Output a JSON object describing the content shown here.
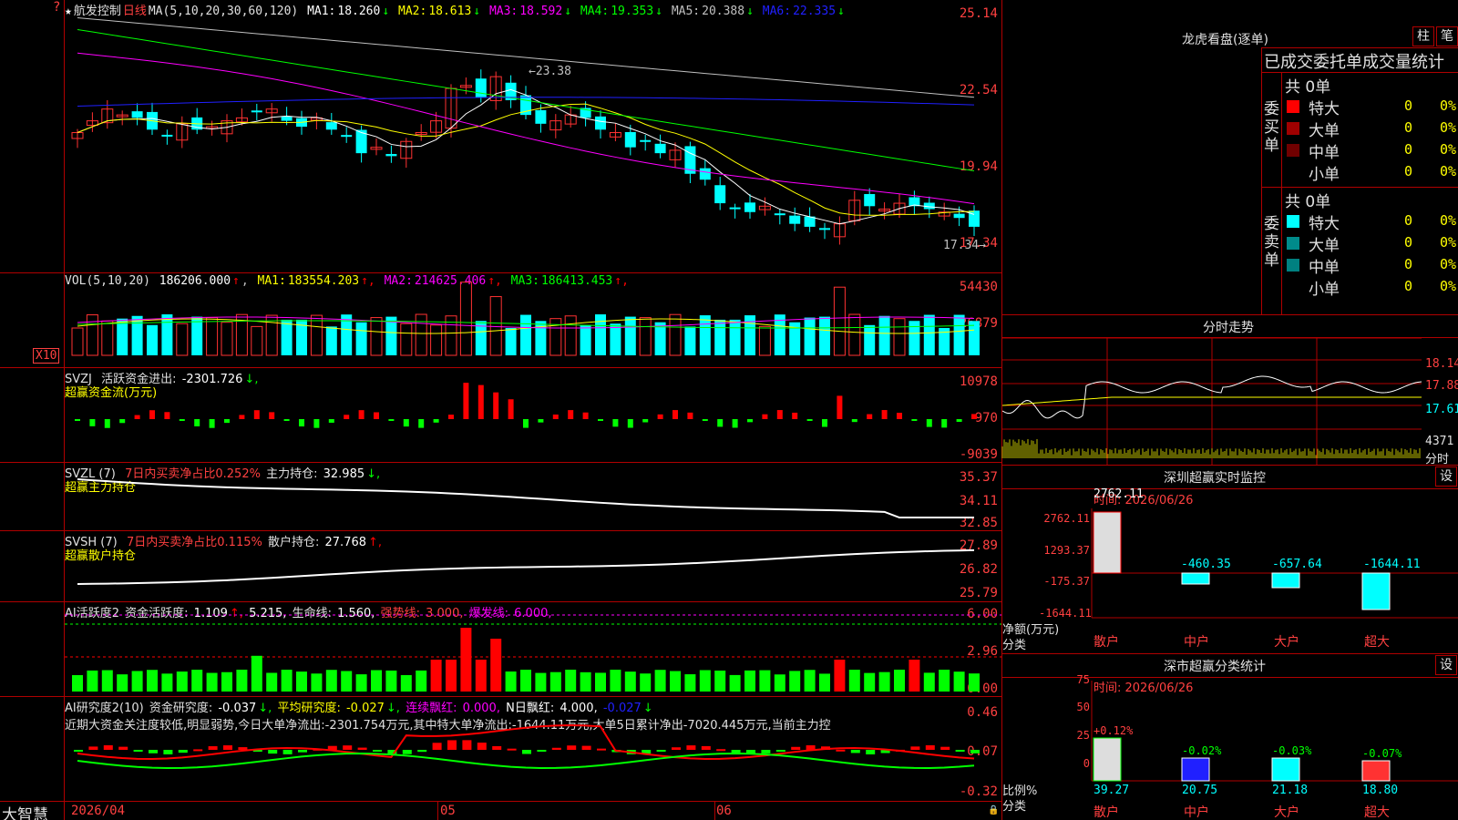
{
  "stock": {
    "name": "航发控制",
    "period": "日线"
  },
  "price_panel": {
    "ma_label": "MA(5,10,20,30,60,120)",
    "ma_values": [
      {
        "name": "MA1:",
        "value": "18.260",
        "color": "#ffffff"
      },
      {
        "name": "MA2:",
        "value": "18.613",
        "color": "#ffff00"
      },
      {
        "name": "MA3:",
        "value": "18.592",
        "color": "#ff00ff"
      },
      {
        "name": "MA4:",
        "value": "19.353",
        "color": "#00ff00"
      },
      {
        "name": "MA5:",
        "value": "20.388",
        "color": "#c0c0c0"
      },
      {
        "name": "MA6:",
        "value": "22.335",
        "color": "#2020ff"
      }
    ],
    "arrow_down": "↓",
    "y_ticks": [
      "25.14",
      "22.54",
      "19.94",
      "17.34"
    ],
    "high_label": "23.38",
    "low_label": "17.34"
  },
  "vol_panel": {
    "label": "VOL(5,10,20)",
    "value": "186206.000",
    "arrow_up": "↑",
    "ma": [
      {
        "name": "MA1:",
        "value": "183554.203",
        "color": "#ffff00"
      },
      {
        "name": "MA2:",
        "value": "214625.406",
        "color": "#ff00ff"
      },
      {
        "name": "MA3:",
        "value": "186413.453",
        "color": "#00ff00"
      }
    ],
    "y_ticks": [
      "54430",
      "26879"
    ],
    "unit": "X10"
  },
  "svzj_panel": {
    "label": "SVZJ",
    "desc": "活跃资金进出:",
    "value": "-2301.726",
    "arrow": "↓,",
    "sub": "超赢资金流(万元)",
    "y_ticks": [
      "10978",
      "970",
      "-9039"
    ]
  },
  "svzl_panel": {
    "label": "SVZL (7)",
    "desc": "7日内买卖净占比0.252%",
    "holding_label": "主力持仓:",
    "holding_value": "32.985",
    "arrow": "↓,",
    "sub": "超赢主力持仓",
    "y_ticks": [
      "35.37",
      "34.11",
      "32.85"
    ]
  },
  "svsh_panel": {
    "label": "SVSH (7)",
    "desc": "7日内买卖净占比0.115%",
    "holding_label": "散户持仓:",
    "holding_value": "27.768",
    "arrow": "↑,",
    "sub": "超赢散户持仓",
    "y_ticks": [
      "27.89",
      "26.82",
      "25.79"
    ]
  },
  "ai_active_panel": {
    "label": "AI活跃度2",
    "f1_label": "资金活跃度:",
    "f1_value": "1.109",
    "f1_arrow": "↑,",
    "f2_value": "5.215,",
    "f3_label": "生命线:",
    "f3_value": "1.560,",
    "f4_label": "强势线:",
    "f4_value": "3.000,",
    "f5_label": "爆发线:",
    "f5_value": "6.000,",
    "y_ticks": [
      "6.00",
      "2.96",
      "0.00"
    ]
  },
  "ai_research_panel": {
    "label": "AI研究度2(10)",
    "f1_label": "资金研究度:",
    "f1_value": "-0.037",
    "f1_arrow": "↓,",
    "f2_label": "平均研究度:",
    "f2_value": "-0.027",
    "f2_arrow": "↓,",
    "f3_label": "连续飘红:",
    "f3_value": "0.000,",
    "f4_label": "N日飘红:",
    "f4_value": "4.000,",
    "f5_value": "-0.027",
    "f5_arrow": "↓",
    "comment": "近期大资金关注度较低,明显弱势,今日大单净流出:-2301.754万元,其中特大单净流出:-1644.11万元,大单5日累计净出-7020.445万元,当前主力控",
    "y_ticks": [
      "0.46",
      "0.07",
      "-0.32"
    ]
  },
  "bottom": {
    "brand": "大智慧",
    "dates": [
      "2026/04",
      "05",
      "06"
    ]
  },
  "dragon_panel": {
    "title": "龙虎看盘(逐单)",
    "btn1": "柱",
    "btn2": "笔",
    "header": "已成交委托单成交量统计",
    "buy_label": "委买单",
    "sell_label": "委卖单",
    "buy_total": "共 0单",
    "sell_total": "共 0单",
    "buy_rows": [
      {
        "label": "特大",
        "count": "0",
        "pct": "0%",
        "color": "#ff0000"
      },
      {
        "label": "大单",
        "count": "0",
        "pct": "0%",
        "color": "#a00000"
      },
      {
        "label": "中单",
        "count": "0",
        "pct": "0%",
        "color": "#700000"
      },
      {
        "label": "小单",
        "count": "0",
        "pct": "0%",
        "color": ""
      }
    ],
    "sell_rows": [
      {
        "label": "特大",
        "count": "0",
        "pct": "0%",
        "color": "#00ffff"
      },
      {
        "label": "大单",
        "count": "0",
        "pct": "0%",
        "color": "#008b8b"
      },
      {
        "label": "中单",
        "count": "0",
        "pct": "0%",
        "color": "#008080"
      },
      {
        "label": "小单",
        "count": "0",
        "pct": "0%",
        "color": ""
      }
    ]
  },
  "intraday_panel": {
    "title": "分时走势",
    "y_ticks": [
      "18.14",
      "17.88",
      "17.61"
    ],
    "vol_tick": "4371",
    "vol_label": "分时"
  },
  "sz_monitor": {
    "title": "深圳超赢实时监控",
    "btn": "设",
    "time_label": "时间: 2026/06/26",
    "y_ticks": [
      "2762.11",
      "1293.37",
      "-175.37",
      "-1644.11"
    ],
    "axis_label": "净额(万元)",
    "axis_label2": "分类",
    "bar_values": [
      "2762.11",
      "-460.35",
      "-657.64",
      "-1644.11"
    ],
    "categories": [
      "散户",
      "中户",
      "大户",
      "超大"
    ]
  },
  "sz_class": {
    "title": "深市超赢分类统计",
    "btn": "设",
    "time_label": "时间: 2026/06/26",
    "y_ticks": [
      "75",
      "50",
      "25",
      "0"
    ],
    "axis_label": "比例%",
    "axis_label2": "分类",
    "top_values": [
      "+0.12%",
      "-0.02%",
      "-0.03%",
      "-0.07%"
    ],
    "bottom_values": [
      "39.27",
      "20.75",
      "21.18",
      "18.80"
    ],
    "categories": [
      "散户",
      "中户",
      "大户",
      "超大"
    ]
  },
  "chart_data": {
    "type": "candlestick",
    "dates_shown": [
      "2026/04",
      "05",
      "06"
    ],
    "ylim": [
      17.34,
      25.14
    ],
    "high": 23.38,
    "low": 17.34
  }
}
